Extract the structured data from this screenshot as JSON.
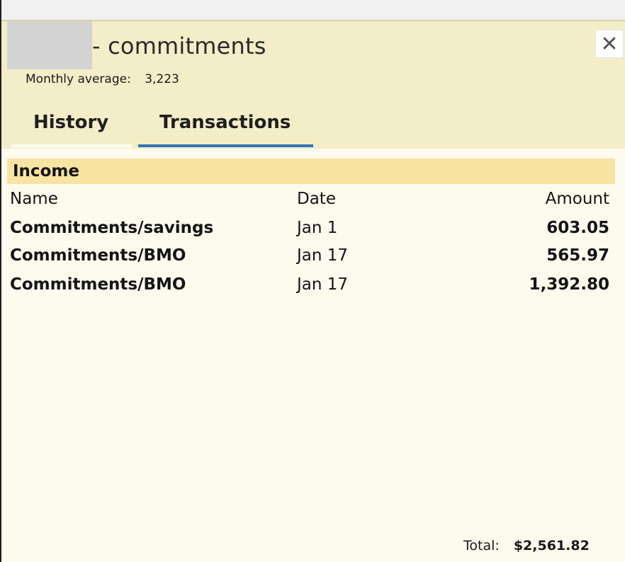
{
  "window": {
    "title": "- commitments",
    "close_glyph": "✕",
    "monthly_average_label": "Monthly average:",
    "monthly_average_value": "3,223"
  },
  "tabs": [
    {
      "label": "History",
      "active": false
    },
    {
      "label": "Transactions",
      "active": true
    }
  ],
  "section": {
    "title": "Income",
    "columns": {
      "name": "Name",
      "date": "Date",
      "amount": "Amount"
    },
    "rows": [
      {
        "name": "Commitments/savings",
        "date": "Jan 1",
        "amount": "603.05"
      },
      {
        "name": "Commitments/BMO",
        "date": "Jan 17",
        "amount": "565.97"
      },
      {
        "name": "Commitments/BMO",
        "date": "Jan 17",
        "amount": "1,392.80"
      }
    ]
  },
  "footer": {
    "total_label": "Total:",
    "total_value": "$2,561.82"
  },
  "colors": {
    "header_bg": "#f3edc8",
    "section_bg": "#f8e4a2",
    "content_bg": "#fdfbee",
    "tab_accent": "#2f74b8"
  },
  "icons": {
    "close": "close-icon"
  }
}
